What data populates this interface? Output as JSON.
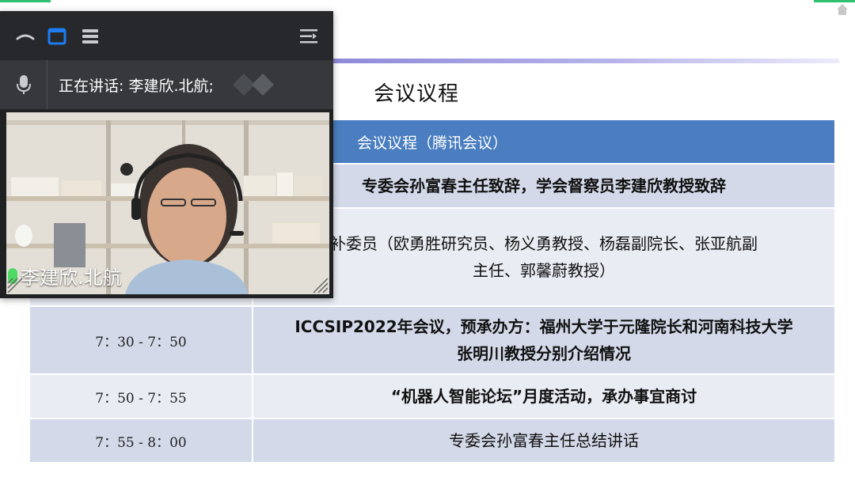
{
  "slide": {
    "title": "会议议程",
    "table_header": "会议议程（腾讯会议）",
    "rows": [
      {
        "time": "",
        "item": "专委会孙富春主任致辞，学会督察员李建欣教授致辞"
      },
      {
        "time": "",
        "item": "补委员（欧勇胜研究员、杨义勇教授、杨磊副院长、张亚航副\n主任、郭馨蔚教授）"
      },
      {
        "time": "7：30 - 7：50",
        "item": "ICCSIP2022年会议，预承办方：福州大学于元隆院长和河南科技大学\n张明川教授分别介绍情况"
      },
      {
        "time": "7：50 - 7：55",
        "item": "“机器人智能论坛”月度活动，承办事宜商讨"
      },
      {
        "time": "7：55 - 8：00",
        "item": "专委会孙富春主任总结讲话"
      }
    ]
  },
  "meeting": {
    "speaking_label": "正在讲话: 李建欣.北航;",
    "participant_name": "李建欣.北航",
    "icons": [
      "minimize-icon",
      "window-view-icon",
      "list-view-icon",
      "expand-panel-icon",
      "microphone-icon",
      "home-icon"
    ],
    "colors": {
      "accent": "#1e7cf0",
      "active_mic": "#4cd964",
      "header": "#4a7ec0"
    }
  }
}
